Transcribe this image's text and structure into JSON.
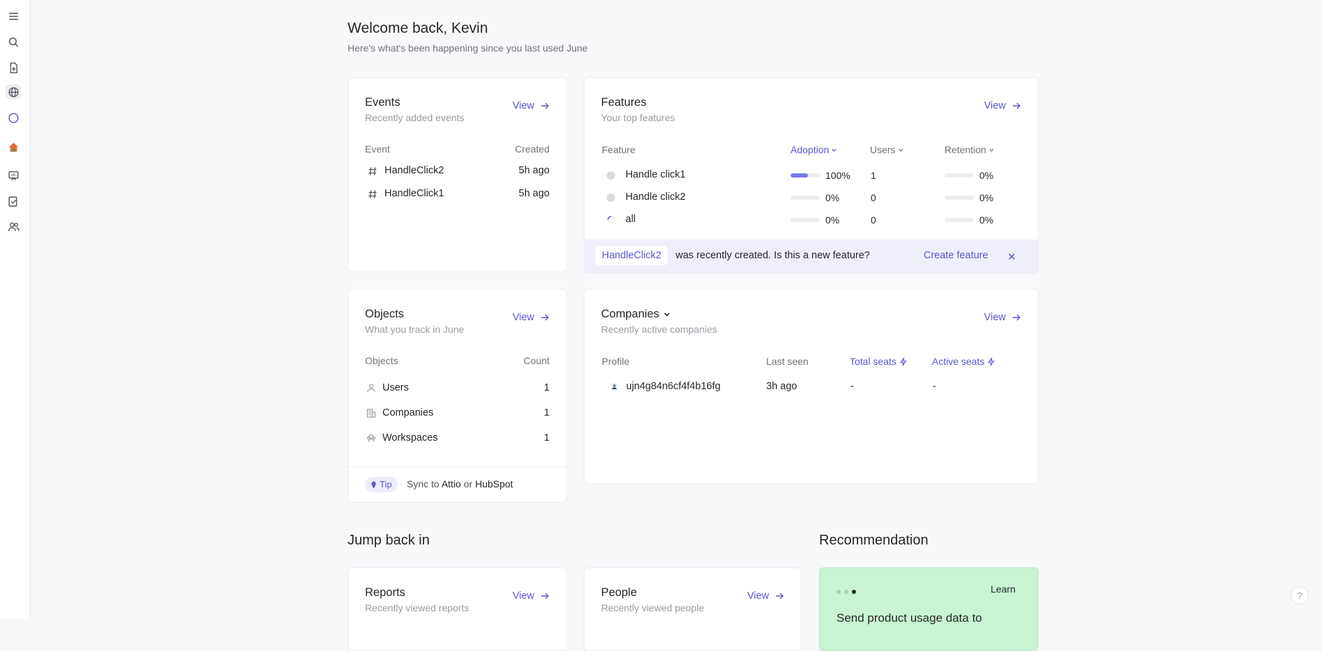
{
  "header": {
    "title": "Welcome back, Kevin",
    "subtitle": "Here's what's been happening since you last used June"
  },
  "sidebar": {
    "items": [
      {
        "icon": "menu-icon"
      },
      {
        "icon": "search-icon"
      },
      {
        "icon": "new-document-icon"
      },
      {
        "icon": "globe-icon"
      },
      {
        "icon": "circle-icon"
      },
      {
        "icon": "home-icon"
      },
      {
        "icon": "reports-icon"
      },
      {
        "icon": "features-icon"
      },
      {
        "icon": "people-icon"
      }
    ]
  },
  "events": {
    "title": "Events",
    "subtitle": "Recently added events",
    "view_label": "View",
    "columns": [
      "Event",
      "Created"
    ],
    "rows": [
      {
        "name": "HandleClick2",
        "created": "5h ago"
      },
      {
        "name": "HandleClick1",
        "created": "5h ago"
      }
    ]
  },
  "features": {
    "title": "Features",
    "subtitle": "Your top features",
    "view_label": "View",
    "columns": [
      "Feature",
      "Adoption",
      "Users",
      "Retention"
    ],
    "rows": [
      {
        "name": "Handle click1",
        "adoption": "100%",
        "adoption_value": 1.0,
        "users": "1",
        "retention": "0%",
        "retention_value": 0
      },
      {
        "name": "Handle click2",
        "adoption": "0%",
        "adoption_value": 0,
        "users": "0",
        "retention": "0%",
        "retention_value": 0
      },
      {
        "name": "all",
        "adoption": "0%",
        "adoption_value": 0,
        "users": "0",
        "retention": "0%",
        "retention_value": 0
      }
    ],
    "banner": {
      "chip": "HandleClick2",
      "text": "was recently created. Is this a new feature?",
      "action": "Create feature"
    }
  },
  "objects": {
    "title": "Objects",
    "subtitle": "What you track in June",
    "view_label": "View",
    "columns": [
      "Objects",
      "Count"
    ],
    "rows": [
      {
        "name": "Users",
        "count": "1"
      },
      {
        "name": "Companies",
        "count": "1"
      },
      {
        "name": "Workspaces",
        "count": "1"
      }
    ],
    "tip": {
      "badge": "Tip",
      "text_before": "Sync to",
      "attio": "Attio",
      "text_or": "or",
      "hubspot": "HubSpot"
    }
  },
  "companies": {
    "title": "Companies",
    "subtitle": "Recently active companies",
    "view_label": "View",
    "columns": [
      "Profile",
      "Last seen",
      "Total seats",
      "Active seats"
    ],
    "rows": [
      {
        "profile": "ujn4g84n6cf4f4b16fg",
        "last_seen": "3h ago",
        "total_seats": "-",
        "active_seats": "-"
      }
    ]
  },
  "jump_back": {
    "title": "Jump back in",
    "reports": {
      "title": "Reports",
      "subtitle": "Recently viewed reports",
      "view_label": "View"
    },
    "people": {
      "title": "People",
      "subtitle": "Recently viewed people",
      "view_label": "View"
    }
  },
  "recommendation": {
    "title": "Recommendation",
    "learn_label": "Learn",
    "headline": "Send product usage data to"
  },
  "help_label": "?",
  "colors": {
    "accent": "#5b57d1",
    "banner": "#efeffc",
    "recommendation": "#c9f3d3"
  }
}
